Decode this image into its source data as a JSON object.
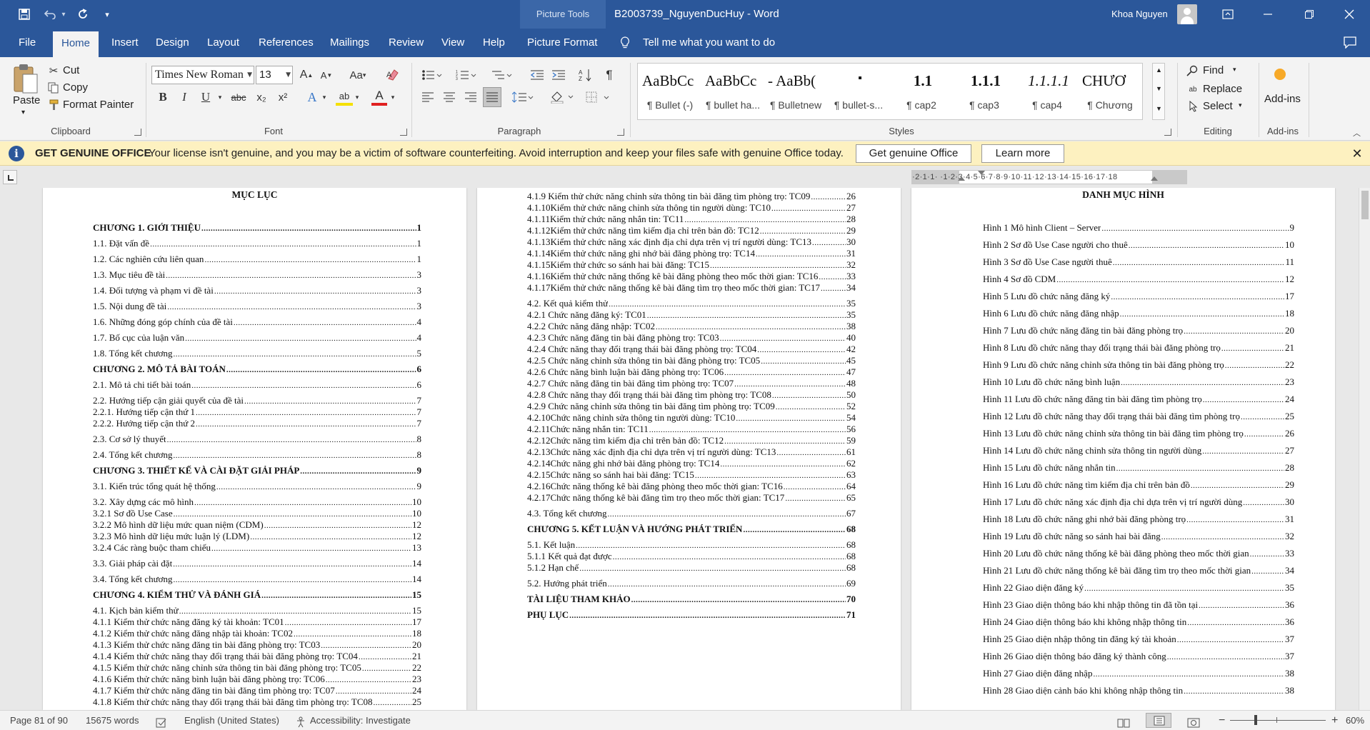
{
  "titlebar": {
    "save_icon": "save-icon",
    "undo_icon": "undo-icon",
    "redo_icon": "redo-icon",
    "customize_icon": "customize-qat-icon",
    "context_tools": "Picture Tools",
    "doc_title": "B2003739_NguyenDucHuy  -  Word",
    "user_name": "Khoa Nguyen"
  },
  "menu": {
    "file": "File",
    "home": "Home",
    "insert": "Insert",
    "design": "Design",
    "layout": "Layout",
    "references": "References",
    "mailings": "Mailings",
    "review": "Review",
    "view": "View",
    "help": "Help",
    "picture_format": "Picture Format",
    "tell_me": "Tell me what you want to do",
    "active_tab": "Home",
    "accent_color": "#2b579a"
  },
  "ribbon": {
    "clipboard": {
      "paste": "Paste",
      "cut": "Cut",
      "copy": "Copy",
      "format_painter": "Format Painter",
      "label": "Clipboard"
    },
    "font": {
      "family": "Times New Roman",
      "size": "13",
      "grow": "A",
      "shrink": "A",
      "change_case": "Aa",
      "bold": "B",
      "italic": "I",
      "underline": "U",
      "strike": "abc",
      "subscript": "x₂",
      "superscript": "x²",
      "text_effects": "A",
      "highlight": "ab",
      "font_color": "A",
      "label": "Font"
    },
    "paragraph": {
      "label": "Paragraph"
    },
    "styles": {
      "label": "Styles",
      "items": [
        {
          "preview": "AaBbCc",
          "name": "¶ Bullet (-)"
        },
        {
          "preview": "AaBbCc",
          "name": "¶ bullet ha..."
        },
        {
          "preview": "- AaBb(",
          "name": "¶ Bulletnew"
        },
        {
          "preview": "▪",
          "name": "¶ bullet-s..."
        },
        {
          "preview": "1.1",
          "name": "¶ cap2"
        },
        {
          "preview": "1.1.1",
          "name": "¶ cap3"
        },
        {
          "preview": "1.1.1.1",
          "name": "¶ cap4"
        },
        {
          "preview": "CHƯƠ",
          "name": "¶ Chương"
        }
      ]
    },
    "editing": {
      "find": "Find",
      "replace": "Replace",
      "select": "Select",
      "label": "Editing"
    },
    "addins": {
      "button": "Add-ins",
      "label": "Add-ins"
    }
  },
  "infobar": {
    "title": "GET GENUINE OFFICE",
    "message": "Your license isn't genuine, and you may be a victim of software counterfeiting. Avoid interruption and keep your files safe with genuine Office today.",
    "get_button": "Get genuine Office",
    "learn_button": "Learn more",
    "background": "#fdf1c0"
  },
  "ruler": {
    "text": "·2·1·1·  ·1·2·3·4·5·6·7·8·9·10·11·12·13·14·15·16·17·18"
  },
  "pages": {
    "page1": {
      "title": "MỤC LỤC",
      "lines": [
        {
          "t": "CHƯƠNG 1.   GIỚI THIỆU",
          "p": "1",
          "b": true
        },
        {
          "t": "1.1.  Đặt vấn đề",
          "p": "1"
        },
        {
          "t": "1.2.  Các nghiên cứu liên quan",
          "p": "1"
        },
        {
          "t": "1.3.  Mục tiêu đề tài",
          "p": "3"
        },
        {
          "t": "1.4.  Đối tượng và phạm vi đề tài",
          "p": "3"
        },
        {
          "t": "1.5.  Nội dung đề tài",
          "p": "3"
        },
        {
          "t": "1.6.  Những đóng góp chính của đề tài",
          "p": "4"
        },
        {
          "t": "1.7.  Bố cục của luận văn",
          "p": "4"
        },
        {
          "t": "1.8.  Tổng kết chương",
          "p": "5"
        },
        {
          "t": "CHƯƠNG 2.   MÔ TẢ BÀI TOÁN",
          "p": "6",
          "b": true
        },
        {
          "t": "2.1.  Mô tả chi tiết bài toán",
          "p": "6"
        },
        {
          "t": "2.2.  Hướng tiếp cận giải quyết của đề tài",
          "p": "7"
        },
        {
          "t": "2.2.1. Hướng tiếp cận thứ 1",
          "p": "7"
        },
        {
          "t": "2.2.2. Hướng tiếp cận thứ 2",
          "p": "7"
        },
        {
          "t": "2.3.  Cơ sở lý thuyết",
          "p": "8"
        },
        {
          "t": "2.4.  Tổng kết chương",
          "p": "8"
        },
        {
          "t": "CHƯƠNG 3.   THIẾT KẾ VÀ CÀI ĐẶT GIẢI PHÁP",
          "p": "9",
          "b": true
        },
        {
          "t": "3.1.  Kiến trúc tổng quát hệ thống",
          "p": "9"
        },
        {
          "t": "3.2.  Xây dựng các mô hình",
          "p": "10"
        },
        {
          "t": "3.2.1  Sơ đồ Use Case",
          "p": "10"
        },
        {
          "t": "3.2.2  Mô hình dữ liệu mức quan niệm (CDM)",
          "p": "12"
        },
        {
          "t": "3.2.3  Mô hình dữ liệu mức luận lý (LDM)",
          "p": "12"
        },
        {
          "t": "3.2.4  Các ràng buộc tham chiếu",
          "p": "13"
        },
        {
          "t": "3.3.  Giải pháp cài đặt",
          "p": "14"
        },
        {
          "t": "3.4.  Tổng kết chương",
          "p": "14"
        },
        {
          "t": "CHƯƠNG 4.   KIỂM THỬ VÀ ĐÁNH GIÁ",
          "p": "15",
          "b": true
        },
        {
          "t": "4.1.  Kịch bản kiểm thử",
          "p": "15"
        },
        {
          "t": "4.1.1  Kiểm thử chức năng đăng ký tài khoản: TC01",
          "p": "17"
        },
        {
          "t": "4.1.2  Kiểm thử chức năng đăng nhập tài khoản: TC02",
          "p": "18"
        },
        {
          "t": "4.1.3  Kiểm thử chức năng đăng tin bài đăng phòng trọ: TC03",
          "p": "20"
        },
        {
          "t": "4.1.4  Kiểm thử chức năng thay đổi trạng thái bài đăng phòng trọ: TC04",
          "p": "21"
        },
        {
          "t": "4.1.5  Kiểm thử chức năng chỉnh sửa thông tin bài đăng phòng trọ: TC05",
          "p": "22"
        },
        {
          "t": "4.1.6  Kiểm thử chức năng bình luận bài đăng phòng trọ: TC06",
          "p": "23"
        },
        {
          "t": "4.1.7  Kiểm thử chức năng đăng tin bài đăng tìm phòng trọ: TC07",
          "p": "24"
        },
        {
          "t": "4.1.8  Kiểm thử chức năng thay đổi trạng thái bài đăng tìm phòng trọ: TC08",
          "p": "25"
        }
      ]
    },
    "page2": {
      "lines": [
        {
          "t": "4.1.9  Kiểm thử chức năng chỉnh sửa thông tin bài đăng tìm phòng trọ: TC09",
          "p": "26"
        },
        {
          "t": "4.1.10Kiểm thử chức năng chỉnh sửa thông tin người dùng: TC10",
          "p": "27"
        },
        {
          "t": "4.1.11Kiểm thử chức năng nhắn tin: TC11",
          "p": "28"
        },
        {
          "t": "4.1.12Kiểm thử chức năng tìm kiếm địa chỉ trên bản đồ: TC12",
          "p": "29"
        },
        {
          "t": "4.1.13Kiểm thử chức năng xác định địa chỉ dựa trên vị trí người dùng: TC13",
          "p": "30"
        },
        {
          "t": "4.1.14Kiểm thử chức năng ghi nhớ bài đăng phòng trọ: TC14",
          "p": "31"
        },
        {
          "t": "4.1.15Kiểm thử chức so sánh hai bài đăng: TC15",
          "p": "32"
        },
        {
          "t": "4.1.16Kiểm thử chức năng thống kê bài đăng phòng theo mốc thời gian: TC16",
          "p": "33"
        },
        {
          "t": "4.1.17Kiểm thử chức năng thống kê bài đăng tìm trọ theo mốc thời gian: TC17",
          "p": "34"
        },
        {
          "t": "4.2.  Kết quả kiểm thử",
          "p": "35"
        },
        {
          "t": "4.2.1  Chức năng đăng ký: TC01",
          "p": "35"
        },
        {
          "t": "4.2.2  Chức năng đăng nhập: TC02",
          "p": "38"
        },
        {
          "t": "4.2.3  Chức năng đăng tin bài đăng phòng trọ: TC03",
          "p": "40"
        },
        {
          "t": "4.2.4  Chức năng thay đổi trạng thái bài đăng phòng trọ: TC04",
          "p": "42"
        },
        {
          "t": "4.2.5  Chức năng chỉnh sửa thông tin bài đăng phòng trọ: TC05",
          "p": "45"
        },
        {
          "t": "4.2.6  Chức năng bình luận bài đăng phòng trọ: TC06",
          "p": "47"
        },
        {
          "t": "4.2.7  Chức năng đăng tin bài đăng tìm phòng trọ: TC07",
          "p": "48"
        },
        {
          "t": "4.2.8  Chức năng thay đổi trạng thái bài đăng tìm phòng trọ: TC08",
          "p": "50"
        },
        {
          "t": "4.2.9  Chức năng chỉnh sửa thông tin bài đăng tìm phòng trọ: TC09",
          "p": "52"
        },
        {
          "t": "4.2.10Chức năng chỉnh sửa thông tin người dùng: TC10",
          "p": "54"
        },
        {
          "t": "4.2.11Chức năng nhắn tin: TC11",
          "p": "56"
        },
        {
          "t": "4.2.12Chức năng tìm kiếm địa chỉ trên bản đồ: TC12",
          "p": "59"
        },
        {
          "t": "4.2.13Chức năng xác định địa chỉ dựa trên vị trí người dùng: TC13",
          "p": "61"
        },
        {
          "t": "4.2.14Chức năng ghi nhớ bài đăng phòng trọ: TC14",
          "p": "62"
        },
        {
          "t": "4.2.15Chức năng so sánh hai bài đăng: TC15",
          "p": "63"
        },
        {
          "t": "4.2.16Chức năng thống kê bài đăng phòng theo mốc thời gian: TC16",
          "p": "64"
        },
        {
          "t": "4.2.17Chức năng thống kê bài đăng tìm trọ theo mốc thời gian: TC17",
          "p": "65"
        },
        {
          "t": "4.3.  Tổng kết chương",
          "p": "67"
        },
        {
          "t": "CHƯƠNG 5.   KẾT LUẬN VÀ HƯỚNG PHÁT TRIỂN",
          "p": "68",
          "b": true
        },
        {
          "t": "5.1.  Kết luận",
          "p": "68"
        },
        {
          "t": "5.1.1  Kết quả đạt được",
          "p": "68"
        },
        {
          "t": "5.1.2  Hạn chế",
          "p": "68"
        },
        {
          "t": "5.2.  Hướng phát triển",
          "p": "69"
        },
        {
          "t": "TÀI LIỆU THAM KHẢO",
          "p": "70",
          "b": true
        },
        {
          "t": "PHỤ LỤC",
          "p": "71",
          "b": true
        }
      ]
    },
    "page3": {
      "title": "DANH MỤC HÌNH",
      "lines": [
        {
          "t": "Hình 1 Mô hình Client – Server",
          "p": "9"
        },
        {
          "t": "Hình 2 Sơ đồ Use Case người cho thuê",
          "p": "10"
        },
        {
          "t": "Hình 3 Sơ đồ Use Case người thuê",
          "p": "11"
        },
        {
          "t": "Hình 4 Sơ đồ CDM",
          "p": "12"
        },
        {
          "t": "Hình 5 Lưu đồ chức năng đăng ký",
          "p": "17"
        },
        {
          "t": "Hình 6 Lưu đồ chức năng đăng nhập",
          "p": "18"
        },
        {
          "t": "Hình 7 Lưu đồ chức năng đăng tin bài đăng phòng trọ",
          "p": "20"
        },
        {
          "t": "Hình 8 Lưu đồ chức năng thay đổi trạng thái bài đăng phòng trọ",
          "p": "21"
        },
        {
          "t": "Hình 9 Lưu đồ chức năng chỉnh sửa thông tin bài đăng phòng trọ",
          "p": "22"
        },
        {
          "t": "Hình 10 Lưu đồ chức năng bình luận",
          "p": "23"
        },
        {
          "t": "Hình 11 Lưu đồ chức năng đăng tin bài đăng tìm phòng trọ",
          "p": "24"
        },
        {
          "t": "Hình 12 Lưu đồ chức năng thay đổi trạng thái bài đăng tìm phòng trọ",
          "p": "25"
        },
        {
          "t": "Hình 13 Lưu đồ chức năng chỉnh sửa thông tin bài đăng tìm phòng trọ",
          "p": "26"
        },
        {
          "t": "Hình 14 Lưu đồ chức năng chỉnh sửa thông tin người dùng",
          "p": "27"
        },
        {
          "t": "Hình 15 Lưu đồ chức năng nhắn tin",
          "p": "28"
        },
        {
          "t": "Hình 16 Lưu đồ chức năng tìm kiếm địa chỉ trên bản đồ",
          "p": "29"
        },
        {
          "t": "Hình 17 Lưu đồ chức năng xác định địa chỉ dựa trên vị trí người dùng",
          "p": "30"
        },
        {
          "t": "Hình 18 Lưu đồ chức năng ghi nhớ bài đăng phòng trọ",
          "p": "31"
        },
        {
          "t": "Hình 19 Lưu đồ chức năng so sánh hai bài đăng",
          "p": "32"
        },
        {
          "t": "Hình 20 Lưu đồ chức năng thống kê bài đăng phòng theo mốc thời gian",
          "p": "33"
        },
        {
          "t": "Hình 21 Lưu đồ chức năng thống kê bài đăng tìm trọ theo mốc thời gian",
          "p": "34"
        },
        {
          "t": "Hình 22 Giao diện đăng ký",
          "p": "35"
        },
        {
          "t": "Hình 23 Giao diện thông báo khi nhập thông tin đã tồn tại",
          "p": "36"
        },
        {
          "t": "Hình 24 Giao diện thông báo khi không nhập thông tin",
          "p": "36"
        },
        {
          "t": "Hình 25 Giao diện nhập thông tin đăng ký tài khoản",
          "p": "37"
        },
        {
          "t": "Hình 26 Giao diện thông báo đăng ký thành công",
          "p": "37"
        },
        {
          "t": "Hình 27 Giao diện đăng nhập",
          "p": "38"
        },
        {
          "t": "Hình 28 Giao diện cảnh báo khi không nhập thông tin",
          "p": "38"
        }
      ]
    }
  },
  "status": {
    "page": "Page 81 of 90",
    "words": "15675 words",
    "language": "English (United States)",
    "accessibility": "Accessibility: Investigate",
    "zoom": "60%",
    "zoom_level_percent": 60
  }
}
